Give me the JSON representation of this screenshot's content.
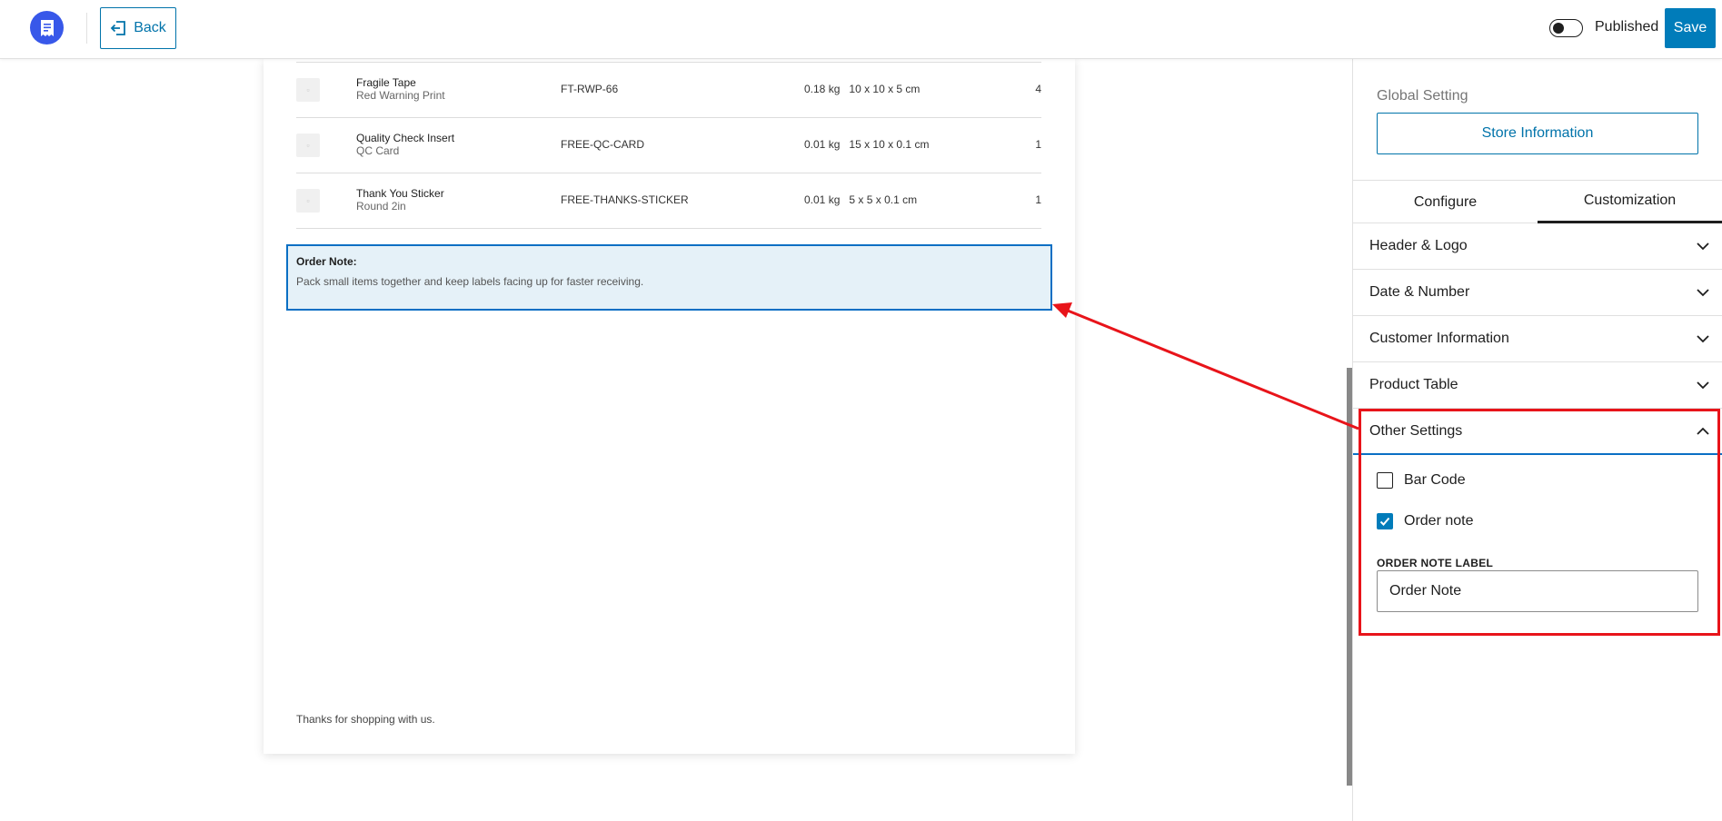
{
  "topbar": {
    "back_label": "Back",
    "status_label": "Published",
    "save_label": "Save"
  },
  "preview": {
    "products": [
      {
        "name": "Fragile Tape",
        "variant": "Red Warning Print",
        "sku": "FT-RWP-66",
        "weight": "0.18 kg",
        "dimensions": "10 x 10 x 5 cm",
        "qty": "4"
      },
      {
        "name": "Quality Check Insert",
        "variant": "QC Card",
        "sku": "FREE-QC-CARD",
        "weight": "0.01 kg",
        "dimensions": "15 x 10 x 0.1 cm",
        "qty": "1"
      },
      {
        "name": "Thank You Sticker",
        "variant": "Round 2in",
        "sku": "FREE-THANKS-STICKER",
        "weight": "0.01 kg",
        "dimensions": "5 x 5 x 0.1 cm",
        "qty": "1"
      }
    ],
    "order_note": {
      "title": "Order Note:",
      "text": "Pack small items together and keep labels facing up for faster receiving."
    },
    "footer_text": "Thanks for shopping with us."
  },
  "sidebar": {
    "global_setting_label": "Global Setting",
    "store_info_button": "Store Information",
    "tabs": [
      {
        "label": "Configure",
        "active": false
      },
      {
        "label": "Customization",
        "active": true
      }
    ],
    "panels": [
      {
        "label": "Header & Logo",
        "open": false
      },
      {
        "label": "Date & Number",
        "open": false
      },
      {
        "label": "Customer Information",
        "open": false
      },
      {
        "label": "Product Table",
        "open": false
      },
      {
        "label": "Other Settings",
        "open": true
      }
    ],
    "other_settings": {
      "options": [
        {
          "label": "Bar Code",
          "checked": false
        },
        {
          "label": "Order note",
          "checked": true
        }
      ],
      "order_note_label_title": "ORDER NOTE LABEL",
      "order_note_label_value": "Order Note"
    }
  },
  "colors": {
    "accent": "#007cba",
    "brand": "#3858e9",
    "annotation": "#e8141a",
    "note_bg": "#e5f1f8"
  }
}
